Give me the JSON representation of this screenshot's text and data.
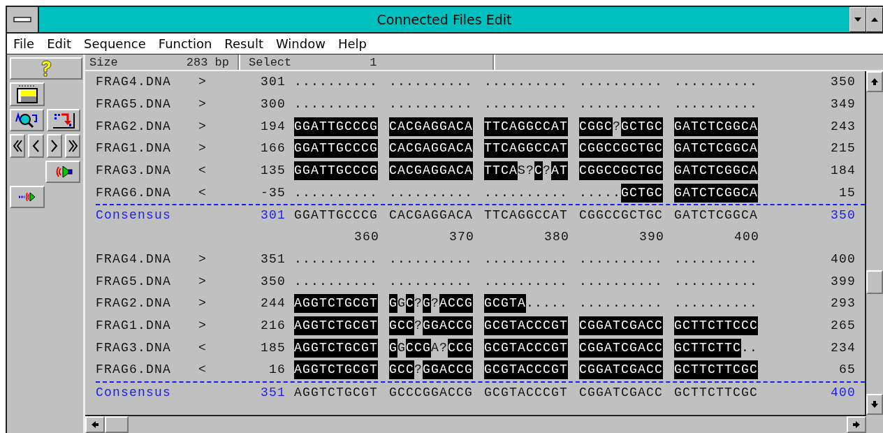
{
  "window": {
    "title": "Connected Files Edit"
  },
  "menu": [
    {
      "label": "File"
    },
    {
      "label": "Edit"
    },
    {
      "label": "Sequence"
    },
    {
      "label": "Function"
    },
    {
      "label": "Result"
    },
    {
      "label": "Window"
    },
    {
      "label": "Help"
    }
  ],
  "status": {
    "size_label": "Size",
    "size_value": "283 bp",
    "select_label": "Select",
    "select_value": "1"
  },
  "blocks": [
    {
      "rows": [
        {
          "name": "FRAG4.DNA",
          "direction": ">",
          "start": "301",
          "end": "350",
          "groups": [
            [
              {
                "text": "..........",
                "highlighted": false
              }
            ],
            [
              {
                "text": "..........",
                "highlighted": false
              }
            ],
            [
              {
                "text": "..........",
                "highlighted": false
              }
            ],
            [
              {
                "text": "..........",
                "highlighted": false
              }
            ],
            [
              {
                "text": "..........",
                "highlighted": false
              }
            ]
          ]
        },
        {
          "name": "FRAG5.DNA",
          "direction": ">",
          "start": "300",
          "end": "349",
          "groups": [
            [
              {
                "text": "..........",
                "highlighted": false
              }
            ],
            [
              {
                "text": "..........",
                "highlighted": false
              }
            ],
            [
              {
                "text": "..........",
                "highlighted": false
              }
            ],
            [
              {
                "text": "..........",
                "highlighted": false
              }
            ],
            [
              {
                "text": "..........",
                "highlighted": false
              }
            ]
          ]
        },
        {
          "name": "FRAG2.DNA",
          "direction": ">",
          "start": "194",
          "end": "243",
          "groups": [
            [
              {
                "text": "GGATTGCCCG",
                "highlighted": true
              }
            ],
            [
              {
                "text": "CACGAGGACA",
                "highlighted": true
              }
            ],
            [
              {
                "text": "TTCAGGCCAT",
                "highlighted": true
              }
            ],
            [
              {
                "text": "CGGC",
                "highlighted": true
              },
              {
                "text": "?",
                "highlighted": false
              },
              {
                "text": "GCTGC",
                "highlighted": true
              }
            ],
            [
              {
                "text": "GATCTCGGCA",
                "highlighted": true
              }
            ]
          ]
        },
        {
          "name": "FRAG1.DNA",
          "direction": ">",
          "start": "166",
          "end": "215",
          "groups": [
            [
              {
                "text": "GGATTGCCCG",
                "highlighted": true
              }
            ],
            [
              {
                "text": "CACGAGGACA",
                "highlighted": true
              }
            ],
            [
              {
                "text": "TTCAGGCCAT",
                "highlighted": true
              }
            ],
            [
              {
                "text": "CGGCCGCTGC",
                "highlighted": true
              }
            ],
            [
              {
                "text": "GATCTCGGCA",
                "highlighted": true
              }
            ]
          ]
        },
        {
          "name": "FRAG3.DNA",
          "direction": "<",
          "start": "135",
          "end": "184",
          "groups": [
            [
              {
                "text": "GGATTGCCCG",
                "highlighted": true
              }
            ],
            [
              {
                "text": "CACGAGGACA",
                "highlighted": true
              }
            ],
            [
              {
                "text": "TTCA",
                "highlighted": true
              },
              {
                "text": "S?",
                "highlighted": false
              },
              {
                "text": "C",
                "highlighted": true
              },
              {
                "text": "?",
                "highlighted": false
              },
              {
                "text": "AT",
                "highlighted": true
              }
            ],
            [
              {
                "text": "CGGCCGCTGC",
                "highlighted": true
              }
            ],
            [
              {
                "text": "GATCTCGGCA",
                "highlighted": true
              }
            ]
          ]
        },
        {
          "name": "FRAG6.DNA",
          "direction": "<",
          "start": "-35",
          "end": "15",
          "groups": [
            [
              {
                "text": "..........",
                "highlighted": false
              }
            ],
            [
              {
                "text": "..........",
                "highlighted": false
              }
            ],
            [
              {
                "text": "..........",
                "highlighted": false
              }
            ],
            [
              {
                "text": ".....",
                "highlighted": false
              },
              {
                "text": "GCTGC",
                "highlighted": true
              }
            ],
            [
              {
                "text": "GATCTCGGCA",
                "highlighted": true
              }
            ]
          ]
        }
      ],
      "consensus": {
        "name": "Consensus",
        "start": "301",
        "end": "350",
        "groups": [
          "GGATTGCCCG",
          "CACGAGGACA",
          "TTCAGGCCAT",
          "CGGCCGCTGC",
          "GATCTCGGCA"
        ]
      },
      "ruler": [
        "360",
        "370",
        "380",
        "390",
        "400"
      ]
    },
    {
      "rows": [
        {
          "name": "FRAG4.DNA",
          "direction": ">",
          "start": "351",
          "end": "400",
          "groups": [
            [
              {
                "text": "..........",
                "highlighted": false
              }
            ],
            [
              {
                "text": "..........",
                "highlighted": false
              }
            ],
            [
              {
                "text": "..........",
                "highlighted": false
              }
            ],
            [
              {
                "text": "..........",
                "highlighted": false
              }
            ],
            [
              {
                "text": "..........",
                "highlighted": false
              }
            ]
          ]
        },
        {
          "name": "FRAG5.DNA",
          "direction": ">",
          "start": "350",
          "end": "399",
          "groups": [
            [
              {
                "text": "..........",
                "highlighted": false
              }
            ],
            [
              {
                "text": "..........",
                "highlighted": false
              }
            ],
            [
              {
                "text": "..........",
                "highlighted": false
              }
            ],
            [
              {
                "text": "..........",
                "highlighted": false
              }
            ],
            [
              {
                "text": "..........",
                "highlighted": false
              }
            ]
          ]
        },
        {
          "name": "FRAG2.DNA",
          "direction": ">",
          "start": "244",
          "end": "293",
          "groups": [
            [
              {
                "text": "AGGTCTGCGT",
                "highlighted": true
              }
            ],
            [
              {
                "text": "G",
                "highlighted": true
              },
              {
                "text": "G",
                "highlighted": false
              },
              {
                "text": "C",
                "highlighted": true
              },
              {
                "text": "?",
                "highlighted": false
              },
              {
                "text": "G",
                "highlighted": true
              },
              {
                "text": "?",
                "highlighted": false
              },
              {
                "text": "ACCG",
                "highlighted": true
              }
            ],
            [
              {
                "text": "GCGTA",
                "highlighted": true
              },
              {
                "text": ".....",
                "highlighted": false
              }
            ],
            [
              {
                "text": "..........",
                "highlighted": false
              }
            ],
            [
              {
                "text": "..........",
                "highlighted": false
              }
            ]
          ]
        },
        {
          "name": "FRAG1.DNA",
          "direction": ">",
          "start": "216",
          "end": "265",
          "groups": [
            [
              {
                "text": "AGGTCTGCGT",
                "highlighted": true
              }
            ],
            [
              {
                "text": "GCC",
                "highlighted": true
              },
              {
                "text": "?",
                "highlighted": false
              },
              {
                "text": "GGACCG",
                "highlighted": true
              }
            ],
            [
              {
                "text": "GCGTACCCGT",
                "highlighted": true
              }
            ],
            [
              {
                "text": "CGGATCGACC",
                "highlighted": true
              }
            ],
            [
              {
                "text": "GCTTCTTCCC",
                "highlighted": true
              }
            ]
          ]
        },
        {
          "name": "FRAG3.DNA",
          "direction": "<",
          "start": "185",
          "end": "234",
          "groups": [
            [
              {
                "text": "AGGTCTGCGT",
                "highlighted": true
              }
            ],
            [
              {
                "text": "G",
                "highlighted": true
              },
              {
                "text": "G",
                "highlighted": false
              },
              {
                "text": "CCG",
                "highlighted": true
              },
              {
                "text": "A?",
                "highlighted": false
              },
              {
                "text": "CCG",
                "highlighted": true
              }
            ],
            [
              {
                "text": "GCGTACCCGT",
                "highlighted": true
              }
            ],
            [
              {
                "text": "CGGATCGACC",
                "highlighted": true
              }
            ],
            [
              {
                "text": "GCTTCTTC",
                "highlighted": true
              },
              {
                "text": "..",
                "highlighted": false
              }
            ]
          ]
        },
        {
          "name": "FRAG6.DNA",
          "direction": "<",
          "start": "16",
          "end": "65",
          "groups": [
            [
              {
                "text": "AGGTCTGCGT",
                "highlighted": true
              }
            ],
            [
              {
                "text": "GCC",
                "highlighted": true
              },
              {
                "text": "?",
                "highlighted": false
              },
              {
                "text": "GGACCG",
                "highlighted": true
              }
            ],
            [
              {
                "text": "GCGTACCCGT",
                "highlighted": true
              }
            ],
            [
              {
                "text": "CGGATCGACC",
                "highlighted": true
              }
            ],
            [
              {
                "text": "GCTTCTTCGC",
                "highlighted": true
              }
            ]
          ]
        }
      ],
      "consensus": {
        "name": "Consensus",
        "start": "351",
        "end": "400",
        "groups": [
          "AGGTCTGCGT",
          "GCCCGGACCG",
          "GCGTACCCGT",
          "CGGATCGACC",
          "GCTTCTTCGC"
        ]
      }
    }
  ]
}
